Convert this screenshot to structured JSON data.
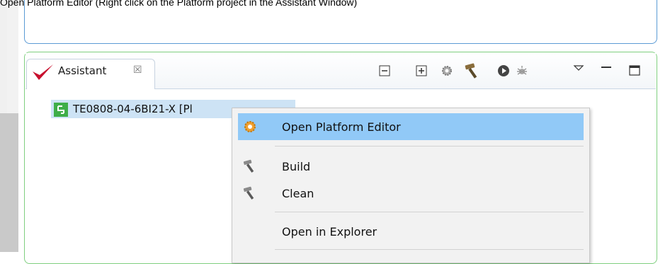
{
  "caption": "Open Platform Editor (Right click on the Platform project in the Assistant Window)",
  "tab": {
    "label": "Assistant",
    "close_symbol": "☒"
  },
  "toolbar": {
    "icons": [
      "collapse-all-icon",
      "expand-all-icon",
      "settings-icon",
      "build-hammer-icon",
      "run-icon",
      "debug-icon",
      "view-menu-icon",
      "minimize-icon",
      "maximize-icon"
    ]
  },
  "tree": {
    "project_label": "TE0808-04-6BI21-X [Pl"
  },
  "menu": {
    "items": [
      {
        "label": "Open Platform Editor",
        "icon": "gear-icon",
        "highlighted": true
      },
      {
        "label": "Build",
        "icon": "hammer-icon"
      },
      {
        "label": "Clean",
        "icon": "hammer-icon"
      },
      {
        "label": "Open in Explorer",
        "icon": ""
      }
    ]
  },
  "colors": {
    "accent_blue": "#5b9bd5",
    "panel_green": "#7fcf7f",
    "menu_highlight": "#91c9f7",
    "selection": "#cde3f5"
  }
}
